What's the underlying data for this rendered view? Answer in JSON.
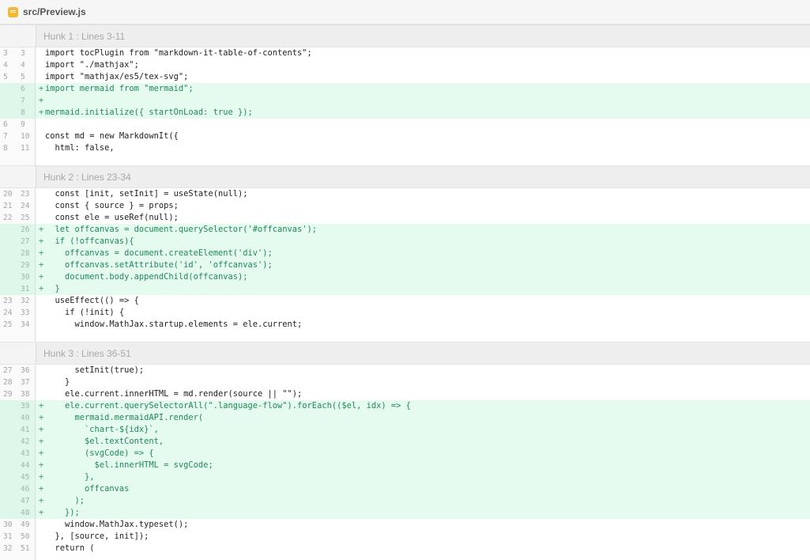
{
  "file": {
    "name": "src/Preview.js",
    "icon": "file-icon"
  },
  "hunks": [
    {
      "title": "Hunk 1 : Lines 3-11",
      "lines": [
        {
          "old": "3",
          "new": "3",
          "type": "context",
          "marker": "",
          "text": "import tocPlugin from \"markdown-it-table-of-contents\";"
        },
        {
          "old": "4",
          "new": "4",
          "type": "context",
          "marker": "",
          "text": "import \"./mathjax\";"
        },
        {
          "old": "5",
          "new": "5",
          "type": "context",
          "marker": "",
          "text": "import \"mathjax/es5/tex-svg\";"
        },
        {
          "old": "",
          "new": "6",
          "type": "added",
          "marker": "+",
          "text": "import mermaid from \"mermaid\";"
        },
        {
          "old": "",
          "new": "7",
          "type": "added",
          "marker": "+",
          "text": ""
        },
        {
          "old": "",
          "new": "8",
          "type": "added",
          "marker": "+",
          "text": "mermaid.initialize({ startOnLoad: true });"
        },
        {
          "old": "6",
          "new": "9",
          "type": "context",
          "marker": "",
          "text": ""
        },
        {
          "old": "7",
          "new": "10",
          "type": "context",
          "marker": "",
          "text": "const md = new MarkdownIt({"
        },
        {
          "old": "8",
          "new": "11",
          "type": "context",
          "marker": "",
          "text": "  html: false,"
        }
      ]
    },
    {
      "title": "Hunk 2 : Lines 23-34",
      "lines": [
        {
          "old": "20",
          "new": "23",
          "type": "context",
          "marker": "",
          "text": "  const [init, setInit] = useState(null);"
        },
        {
          "old": "21",
          "new": "24",
          "type": "context",
          "marker": "",
          "text": "  const { source } = props;"
        },
        {
          "old": "22",
          "new": "25",
          "type": "context",
          "marker": "",
          "text": "  const ele = useRef(null);"
        },
        {
          "old": "",
          "new": "26",
          "type": "added",
          "marker": "+",
          "text": "  let offcanvas = document.querySelector('#offcanvas');"
        },
        {
          "old": "",
          "new": "27",
          "type": "added",
          "marker": "+",
          "text": "  if (!offcanvas){"
        },
        {
          "old": "",
          "new": "28",
          "type": "added",
          "marker": "+",
          "text": "    offcanvas = document.createElement('div');"
        },
        {
          "old": "",
          "new": "29",
          "type": "added",
          "marker": "+",
          "text": "    offcanvas.setAttribute('id', 'offcanvas');"
        },
        {
          "old": "",
          "new": "30",
          "type": "added",
          "marker": "+",
          "text": "    document.body.appendChild(offcanvas);"
        },
        {
          "old": "",
          "new": "31",
          "type": "added",
          "marker": "+",
          "text": "  }"
        },
        {
          "old": "23",
          "new": "32",
          "type": "context",
          "marker": "",
          "text": "  useEffect(() => {"
        },
        {
          "old": "24",
          "new": "33",
          "type": "context",
          "marker": "",
          "text": "    if (!init) {"
        },
        {
          "old": "25",
          "new": "34",
          "type": "context",
          "marker": "",
          "text": "      window.MathJax.startup.elements = ele.current;"
        }
      ]
    },
    {
      "title": "Hunk 3 : Lines 36-51",
      "lines": [
        {
          "old": "27",
          "new": "36",
          "type": "context",
          "marker": "",
          "text": "      setInit(true);"
        },
        {
          "old": "28",
          "new": "37",
          "type": "context",
          "marker": "",
          "text": "    }"
        },
        {
          "old": "29",
          "new": "38",
          "type": "context",
          "marker": "",
          "text": "    ele.current.innerHTML = md.render(source || \"\");"
        },
        {
          "old": "",
          "new": "39",
          "type": "added",
          "marker": "+",
          "text": "    ele.current.querySelectorAll(\".language-flow\").forEach(($el, idx) => {"
        },
        {
          "old": "",
          "new": "40",
          "type": "added",
          "marker": "+",
          "text": "      mermaid.mermaidAPI.render("
        },
        {
          "old": "",
          "new": "41",
          "type": "added",
          "marker": "+",
          "text": "        `chart-${idx}`,"
        },
        {
          "old": "",
          "new": "42",
          "type": "added",
          "marker": "+",
          "text": "        $el.textContent,"
        },
        {
          "old": "",
          "new": "43",
          "type": "added",
          "marker": "+",
          "text": "        (svgCode) => {"
        },
        {
          "old": "",
          "new": "44",
          "type": "added",
          "marker": "+",
          "text": "          $el.innerHTML = svgCode;"
        },
        {
          "old": "",
          "new": "45",
          "type": "added",
          "marker": "+",
          "text": "        },"
        },
        {
          "old": "",
          "new": "46",
          "type": "added",
          "marker": "+",
          "text": "        offcanvas"
        },
        {
          "old": "",
          "new": "47",
          "type": "added",
          "marker": "+",
          "text": "      );"
        },
        {
          "old": "",
          "new": "48",
          "type": "added",
          "marker": "+",
          "text": "    });"
        },
        {
          "old": "30",
          "new": "49",
          "type": "context",
          "marker": "",
          "text": "    window.MathJax.typeset();"
        },
        {
          "old": "31",
          "new": "50",
          "type": "context",
          "marker": "",
          "text": "  }, [source, init]);"
        },
        {
          "old": "32",
          "new": "51",
          "type": "context",
          "marker": "",
          "text": "  return ("
        }
      ]
    }
  ],
  "colors": {
    "added_bg": "#e6fbef",
    "added_text": "#1e8a57",
    "hunk_header_bg": "#eeeeee",
    "file_icon": "#f5b731"
  }
}
